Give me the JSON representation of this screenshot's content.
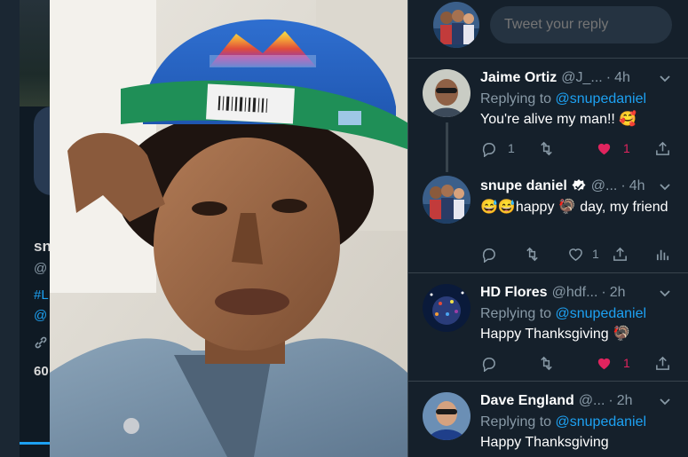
{
  "left_profile": {
    "name_partial": "sn",
    "handle_partial": "@",
    "hashtag_partial": "#L",
    "mention_partial": "@",
    "count_partial": "60"
  },
  "composer": {
    "placeholder": "Tweet your reply"
  },
  "replies": [
    {
      "name": "Jaime Ortiz",
      "handle": "@J_...",
      "time": "4h",
      "replying_prefix": "Replying to",
      "replying_to": "@snupedaniel",
      "text": "You're alive my man!! 🥰",
      "reply_count": "1",
      "retweet_count": "",
      "like_count": "1",
      "liked": true
    },
    {
      "name": "snupe daniel",
      "handle": "@...",
      "time": "4h",
      "verified": true,
      "text": "😅😅happy 🦃 day, my friend",
      "reply_count": "",
      "retweet_count": "",
      "like_count": "1",
      "liked": false
    },
    {
      "name": "HD Flores",
      "handle": "@hdf...",
      "time": "2h",
      "replying_prefix": "Replying to",
      "replying_to": "@snupedaniel",
      "text": "Happy Thanksgiving 🦃",
      "reply_count": "",
      "retweet_count": "",
      "like_count": "1",
      "liked": true
    },
    {
      "name": "Dave England",
      "handle": "@...",
      "time": "2h",
      "replying_prefix": "Replying to",
      "replying_to": "@snupedaniel",
      "text": "Happy Thanksgiving"
    }
  ],
  "colors": {
    "background": "#15202b",
    "accent": "#1da1f2",
    "like": "#e0245e",
    "muted": "#8899a6",
    "border": "#38444d"
  },
  "icons": {
    "reply": "speech-bubble-icon",
    "retweet": "retweet-arrows-icon",
    "like": "heart-icon",
    "share": "share-upload-icon",
    "analytics": "bar-chart-icon",
    "more": "chevron-down-icon",
    "verified": "verified-badge-icon"
  }
}
